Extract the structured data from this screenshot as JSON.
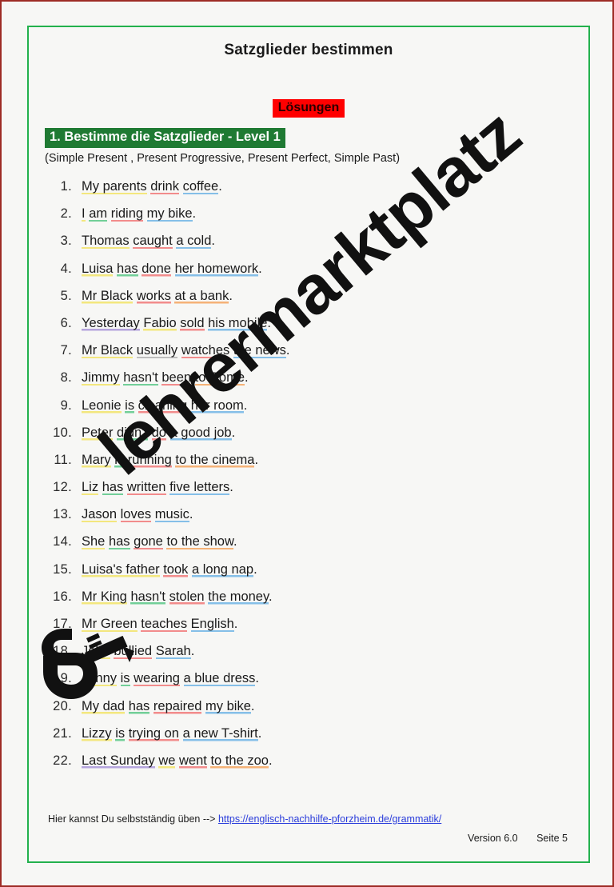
{
  "page": {
    "title": "Satzglieder bestimmen",
    "solutions_badge": "Lösungen",
    "task_heading": "1. Bestimme die Satzglieder - Level 1",
    "task_subheading": "(Simple Present , Present Progressive, Present Perfect, Simple Past)"
  },
  "colors": {
    "outer_border": "#9e2b25",
    "inner_border": "#23b14d",
    "page_background": "#f7f7f5",
    "solutions_badge_bg": "#ff0000",
    "task_badge_bg": "#1f7a33",
    "link": "#2b3ddb",
    "underline_subject": "#f3e77e",
    "underline_verb": "#f28c8c",
    "underline_object": "#85bfe8",
    "underline_auxiliary": "#72cf98",
    "underline_place": "#f5b277",
    "underline_time": "#b5a5dd",
    "underline_frequency": "#bdbdbd"
  },
  "sentences": [
    {
      "num": "1.",
      "parts": [
        {
          "t": "My parents",
          "c": "subject"
        },
        {
          "t": " ",
          "c": "none"
        },
        {
          "t": "drink",
          "c": "verb"
        },
        {
          "t": " ",
          "c": "none"
        },
        {
          "t": "coffee",
          "c": "object"
        },
        {
          "t": ".",
          "c": "none"
        }
      ]
    },
    {
      "num": "2.",
      "parts": [
        {
          "t": "I",
          "c": "subject"
        },
        {
          "t": " ",
          "c": "none"
        },
        {
          "t": "am",
          "c": "aux"
        },
        {
          "t": " ",
          "c": "none"
        },
        {
          "t": "riding",
          "c": "verb"
        },
        {
          "t": " ",
          "c": "none"
        },
        {
          "t": "my bike",
          "c": "object"
        },
        {
          "t": ".",
          "c": "none"
        }
      ]
    },
    {
      "num": "3.",
      "parts": [
        {
          "t": "Thomas",
          "c": "subject"
        },
        {
          "t": " ",
          "c": "none"
        },
        {
          "t": "caught",
          "c": "verb"
        },
        {
          "t": " ",
          "c": "none"
        },
        {
          "t": "a cold",
          "c": "object"
        },
        {
          "t": ".",
          "c": "none"
        }
      ]
    },
    {
      "num": "4.",
      "parts": [
        {
          "t": "Luisa",
          "c": "subject"
        },
        {
          "t": " ",
          "c": "none"
        },
        {
          "t": "has",
          "c": "aux"
        },
        {
          "t": " ",
          "c": "none"
        },
        {
          "t": "done",
          "c": "verb"
        },
        {
          "t": " ",
          "c": "none"
        },
        {
          "t": "her homework",
          "c": "object"
        },
        {
          "t": ".",
          "c": "none"
        }
      ]
    },
    {
      "num": "5.",
      "parts": [
        {
          "t": "Mr Black",
          "c": "subject"
        },
        {
          "t": " ",
          "c": "none"
        },
        {
          "t": "works",
          "c": "verb"
        },
        {
          "t": " ",
          "c": "none"
        },
        {
          "t": "at a bank",
          "c": "place"
        },
        {
          "t": ".",
          "c": "none"
        }
      ]
    },
    {
      "num": "6.",
      "parts": [
        {
          "t": "Yesterday",
          "c": "time"
        },
        {
          "t": " ",
          "c": "none"
        },
        {
          "t": "Fabio",
          "c": "subject"
        },
        {
          "t": " ",
          "c": "none"
        },
        {
          "t": "sold",
          "c": "verb"
        },
        {
          "t": " ",
          "c": "none"
        },
        {
          "t": "his mobile",
          "c": "object"
        },
        {
          "t": ".",
          "c": "none"
        }
      ]
    },
    {
      "num": "7.",
      "parts": [
        {
          "t": "Mr Black",
          "c": "subject"
        },
        {
          "t": " ",
          "c": "none"
        },
        {
          "t": "usually",
          "c": "freq"
        },
        {
          "t": " ",
          "c": "none"
        },
        {
          "t": "watches",
          "c": "verb"
        },
        {
          "t": " ",
          "c": "none"
        },
        {
          "t": "the news",
          "c": "object"
        },
        {
          "t": ".",
          "c": "none"
        }
      ]
    },
    {
      "num": "8.",
      "parts": [
        {
          "t": "Jimmy",
          "c": "subject"
        },
        {
          "t": " ",
          "c": "none"
        },
        {
          "t": "hasn't",
          "c": "aux"
        },
        {
          "t": " ",
          "c": "none"
        },
        {
          "t": "been",
          "c": "verb"
        },
        {
          "t": " ",
          "c": "none"
        },
        {
          "t": "to Rome",
          "c": "place"
        },
        {
          "t": ".",
          "c": "none"
        }
      ]
    },
    {
      "num": "9.",
      "parts": [
        {
          "t": "Leonie",
          "c": "subject"
        },
        {
          "t": " ",
          "c": "none"
        },
        {
          "t": "is",
          "c": "aux"
        },
        {
          "t": " ",
          "c": "none"
        },
        {
          "t": "cleaning",
          "c": "verb"
        },
        {
          "t": " ",
          "c": "none"
        },
        {
          "t": "her room",
          "c": "object"
        },
        {
          "t": ".",
          "c": "none"
        }
      ]
    },
    {
      "num": "10.",
      "parts": [
        {
          "t": "Peter",
          "c": "subject"
        },
        {
          "t": " ",
          "c": "none"
        },
        {
          "t": "didn't",
          "c": "aux"
        },
        {
          "t": " ",
          "c": "none"
        },
        {
          "t": "do",
          "c": "verb"
        },
        {
          "t": " ",
          "c": "none"
        },
        {
          "t": "a good job",
          "c": "object"
        },
        {
          "t": ".",
          "c": "none"
        }
      ]
    },
    {
      "num": "11.",
      "parts": [
        {
          "t": "Mary",
          "c": "subject"
        },
        {
          "t": " ",
          "c": "none"
        },
        {
          "t": "is",
          "c": "aux"
        },
        {
          "t": " ",
          "c": "none"
        },
        {
          "t": "running",
          "c": "verb"
        },
        {
          "t": " ",
          "c": "none"
        },
        {
          "t": "to the cinema",
          "c": "place"
        },
        {
          "t": ".",
          "c": "none"
        }
      ]
    },
    {
      "num": "12.",
      "parts": [
        {
          "t": "Liz",
          "c": "subject"
        },
        {
          "t": " ",
          "c": "none"
        },
        {
          "t": "has",
          "c": "aux"
        },
        {
          "t": " ",
          "c": "none"
        },
        {
          "t": "written",
          "c": "verb"
        },
        {
          "t": " ",
          "c": "none"
        },
        {
          "t": "five letters",
          "c": "object"
        },
        {
          "t": ".",
          "c": "none"
        }
      ]
    },
    {
      "num": "13.",
      "parts": [
        {
          "t": "Jason",
          "c": "subject"
        },
        {
          "t": " ",
          "c": "none"
        },
        {
          "t": "loves",
          "c": "verb"
        },
        {
          "t": " ",
          "c": "none"
        },
        {
          "t": "music",
          "c": "object"
        },
        {
          "t": ".",
          "c": "none"
        }
      ]
    },
    {
      "num": "14.",
      "parts": [
        {
          "t": "She",
          "c": "subject"
        },
        {
          "t": " ",
          "c": "none"
        },
        {
          "t": "has",
          "c": "aux"
        },
        {
          "t": " ",
          "c": "none"
        },
        {
          "t": "gone",
          "c": "verb"
        },
        {
          "t": " ",
          "c": "none"
        },
        {
          "t": "to the show",
          "c": "place"
        },
        {
          "t": ".",
          "c": "none"
        }
      ]
    },
    {
      "num": "15.",
      "parts": [
        {
          "t": "Luisa's father",
          "c": "subject"
        },
        {
          "t": " ",
          "c": "none"
        },
        {
          "t": "took",
          "c": "verb"
        },
        {
          "t": " ",
          "c": "none"
        },
        {
          "t": "a long nap",
          "c": "object"
        },
        {
          "t": ".",
          "c": "none"
        }
      ]
    },
    {
      "num": "16.",
      "parts": [
        {
          "t": "Mr King",
          "c": "subject"
        },
        {
          "t": " ",
          "c": "none"
        },
        {
          "t": "hasn't",
          "c": "aux"
        },
        {
          "t": " ",
          "c": "none"
        },
        {
          "t": "stolen",
          "c": "verb"
        },
        {
          "t": " ",
          "c": "none"
        },
        {
          "t": "the money",
          "c": "object"
        },
        {
          "t": ".",
          "c": "none"
        }
      ]
    },
    {
      "num": "17.",
      "parts": [
        {
          "t": "Mr Green",
          "c": "subject"
        },
        {
          "t": " ",
          "c": "none"
        },
        {
          "t": "teaches",
          "c": "verb"
        },
        {
          "t": " ",
          "c": "none"
        },
        {
          "t": "English",
          "c": "object"
        },
        {
          "t": ".",
          "c": "none"
        }
      ]
    },
    {
      "num": "18.",
      "parts": [
        {
          "t": "John",
          "c": "subject"
        },
        {
          "t": " ",
          "c": "none"
        },
        {
          "t": "bullied",
          "c": "verb"
        },
        {
          "t": " ",
          "c": "none"
        },
        {
          "t": "Sarah",
          "c": "object"
        },
        {
          "t": ".",
          "c": "none"
        }
      ]
    },
    {
      "num": "19.",
      "parts": [
        {
          "t": "Jenny",
          "c": "subject"
        },
        {
          "t": " ",
          "c": "none"
        },
        {
          "t": "is",
          "c": "aux"
        },
        {
          "t": " ",
          "c": "none"
        },
        {
          "t": "wearing",
          "c": "verb"
        },
        {
          "t": " ",
          "c": "none"
        },
        {
          "t": "a blue dress",
          "c": "object"
        },
        {
          "t": ".",
          "c": "none"
        }
      ]
    },
    {
      "num": "20.",
      "parts": [
        {
          "t": "My dad",
          "c": "subject"
        },
        {
          "t": " ",
          "c": "none"
        },
        {
          "t": "has",
          "c": "aux"
        },
        {
          "t": " ",
          "c": "none"
        },
        {
          "t": "repaired",
          "c": "verb"
        },
        {
          "t": " ",
          "c": "none"
        },
        {
          "t": "my bike",
          "c": "object"
        },
        {
          "t": ".",
          "c": "none"
        }
      ]
    },
    {
      "num": "21.",
      "parts": [
        {
          "t": "Lizzy",
          "c": "subject"
        },
        {
          "t": " ",
          "c": "none"
        },
        {
          "t": "is",
          "c": "aux"
        },
        {
          "t": " ",
          "c": "none"
        },
        {
          "t": "trying on",
          "c": "verb"
        },
        {
          "t": " ",
          "c": "none"
        },
        {
          "t": "a new T-shirt",
          "c": "object"
        },
        {
          "t": ".",
          "c": "none"
        }
      ]
    },
    {
      "num": "22.",
      "parts": [
        {
          "t": "Last Sunday",
          "c": "time"
        },
        {
          "t": " ",
          "c": "none"
        },
        {
          "t": "we",
          "c": "subject"
        },
        {
          "t": " ",
          "c": "none"
        },
        {
          "t": "went",
          "c": "verb"
        },
        {
          "t": " ",
          "c": "none"
        },
        {
          "t": "to the zoo",
          "c": "place"
        },
        {
          "t": ".",
          "c": "none"
        }
      ]
    }
  ],
  "footer": {
    "note_prefix": "Hier kannst Du selbstständig üben -->",
    "link": "https://englisch-nachhilfe-pforzheim.de/grammatik/",
    "version": "Version 6.0",
    "page_label": "Seite 5"
  },
  "watermark": {
    "text": "lehrermarktplatz",
    "logo_name": "lehrermarktplatz-logo"
  }
}
